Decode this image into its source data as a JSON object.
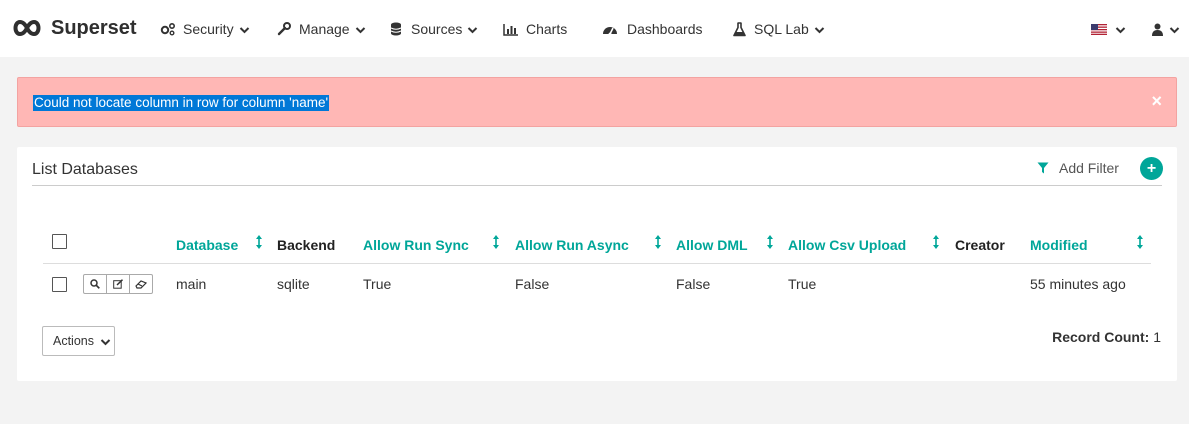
{
  "brand": {
    "name": "Superset"
  },
  "nav": {
    "security": "Security",
    "manage": "Manage",
    "sources": "Sources",
    "charts": "Charts",
    "dashboards": "Dashboards",
    "sql_lab": "SQL Lab"
  },
  "icons": {
    "brand": "superset-infinity-logo",
    "security": "cogs-icon",
    "manage": "wrench-icon",
    "sources": "database-icon",
    "charts": "bar-chart-icon",
    "dashboards": "dashboard-gauge-icon",
    "sql_lab": "flask-icon",
    "language": "us-flag-icon",
    "user": "user-icon"
  },
  "colors": {
    "accent": "#00a699",
    "alert_bg": "#ffb7b5",
    "selection": "#0078d7"
  },
  "alert": {
    "message": "Could not locate column in row for column 'name'",
    "close": "×"
  },
  "panel": {
    "title": "List Databases",
    "add_filter": "Add Filter",
    "add_button": "+"
  },
  "table": {
    "columns": {
      "database": "Database",
      "backend": "Backend",
      "allow_run_sync": "Allow Run Sync",
      "allow_run_async": "Allow Run Async",
      "allow_dml": "Allow DML",
      "allow_csv_upload": "Allow Csv Upload",
      "creator": "Creator",
      "modified": "Modified"
    },
    "rows": [
      {
        "database": "main",
        "backend": "sqlite",
        "allow_run_sync": "True",
        "allow_run_async": "False",
        "allow_dml": "False",
        "allow_csv_upload": "True",
        "creator": "",
        "modified": "55 minutes ago"
      }
    ]
  },
  "footer": {
    "actions": "Actions",
    "record_count_label": "Record Count:",
    "record_count_value": "1"
  }
}
